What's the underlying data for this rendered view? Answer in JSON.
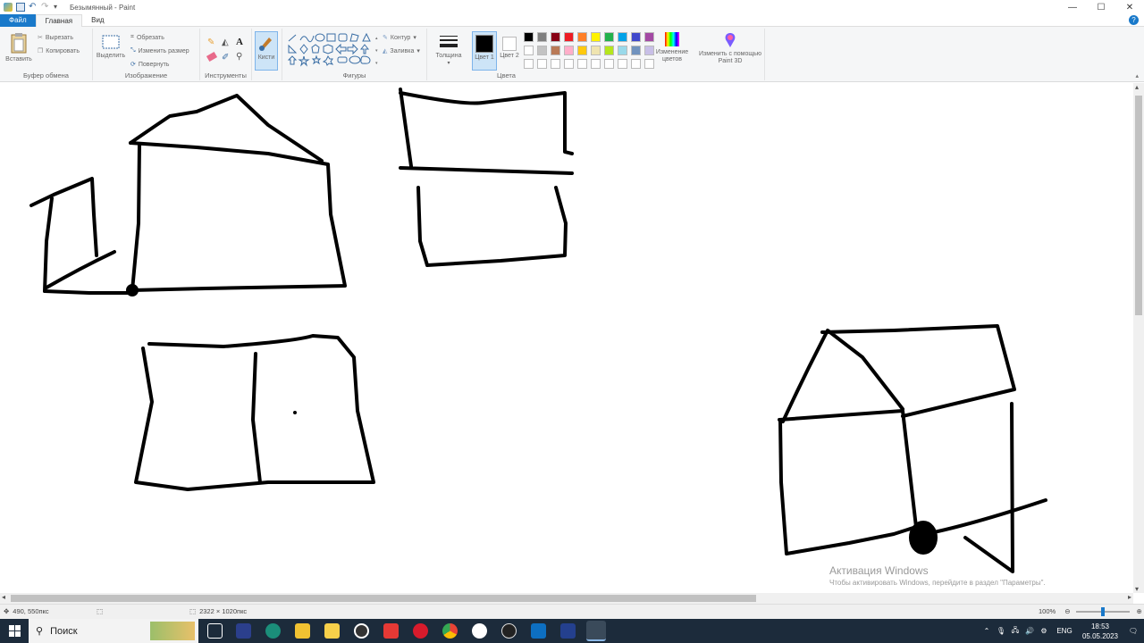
{
  "window": {
    "title": "Безымянный - Paint",
    "quick_access_dropdown": "▾"
  },
  "tabs": [
    {
      "label": "Файл"
    },
    {
      "label": "Главная"
    },
    {
      "label": "Вид"
    }
  ],
  "clipboard": {
    "paste_label": "Вставить",
    "cut_label": "Вырезать",
    "copy_label": "Копировать",
    "group_label": "Буфер обмена"
  },
  "image": {
    "select_label": "Выделить",
    "crop_label": "Обрезать",
    "resize_label": "Изменить размер",
    "rotate_label": "Повернуть",
    "group_label": "Изображение"
  },
  "tools": {
    "group_label": "Инструменты",
    "text_tool_glyph": "A"
  },
  "brushes": {
    "label": "Кисти"
  },
  "shapes": {
    "outline_label": "Контур",
    "fill_label": "Заливка",
    "group_label": "Фигуры"
  },
  "size": {
    "label": "Толщина"
  },
  "colors": {
    "color1_label": "Цвет 1",
    "color2_label": "Цвет 2",
    "edit_colors_label": "Изменение цветов",
    "paint3d_label": "Изменить с помощью Paint 3D",
    "group_label": "Цвета",
    "color1": "#000000",
    "color2": "#ffffff",
    "palette_row1": [
      "#000000",
      "#7f7f7f",
      "#880015",
      "#ed1c24",
      "#ff7f27",
      "#fff200",
      "#22b14c",
      "#00a2e8",
      "#3f48cc",
      "#a349a4"
    ],
    "palette_row2": [
      "#ffffff",
      "#c3c3c3",
      "#b97a57",
      "#ffaec9",
      "#ffc90e",
      "#efe4b0",
      "#b5e61d",
      "#99d9ea",
      "#7092be",
      "#c8bfe7"
    ],
    "palette_row3": [
      "#ffffff",
      "#ffffff",
      "#ffffff",
      "#ffffff",
      "#ffffff",
      "#ffffff",
      "#ffffff",
      "#ffffff",
      "#ffffff",
      "#ffffff"
    ]
  },
  "status": {
    "cursor_pos": "490, 550пкс",
    "image_size": "2322 × 1020пкс",
    "zoom": "100%"
  },
  "watermark": {
    "title": "Активация Windows",
    "subtitle": "Чтобы активировать Windows, перейдите в раздел \"Параметры\"."
  },
  "taskbar": {
    "search_placeholder": "Поиск",
    "language": "ENG",
    "time": "18:53",
    "date": "05.05.2023"
  }
}
